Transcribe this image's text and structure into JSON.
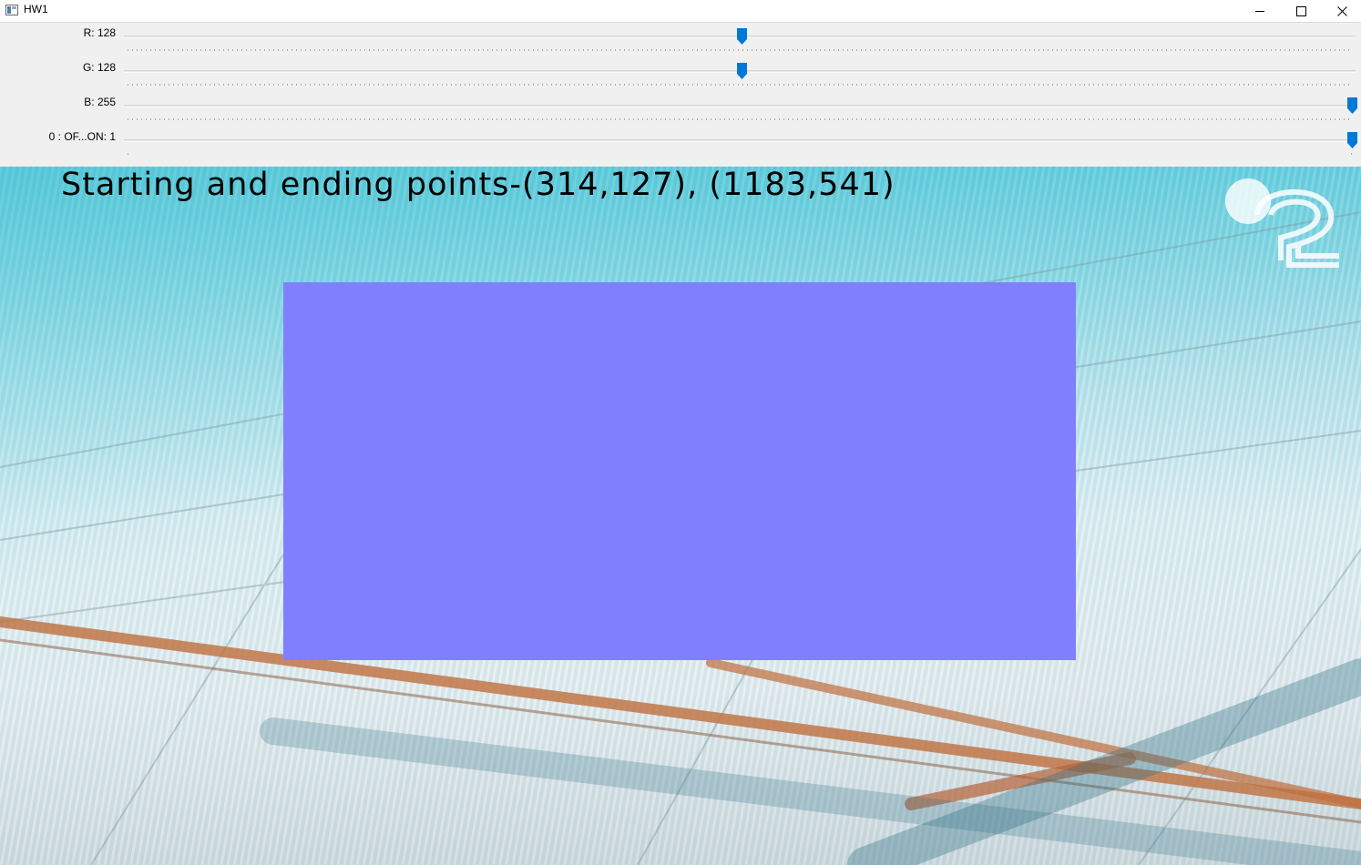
{
  "window": {
    "title": "HW1",
    "icon": "app-window-icon",
    "controls": {
      "minimize_icon": "minimize-icon",
      "maximize_icon": "maximize-icon",
      "close_icon": "close-icon"
    }
  },
  "trackbars": [
    {
      "label": "R: 128",
      "value": 128,
      "max": 255
    },
    {
      "label": "G: 128",
      "value": 128,
      "max": 255
    },
    {
      "label": "B: 255",
      "value": 255,
      "max": 255
    },
    {
      "label": "0 : OF...ON: 1",
      "value": 1,
      "max": 1
    }
  ],
  "canvas": {
    "caption": "Starting and ending points-(314,127), (1183,541)",
    "rect_color": "#8080ff",
    "logo_icon": "watermark-logo"
  },
  "colors": {
    "thumb": "#0078d7",
    "panel_bg": "#f0f0f0"
  }
}
